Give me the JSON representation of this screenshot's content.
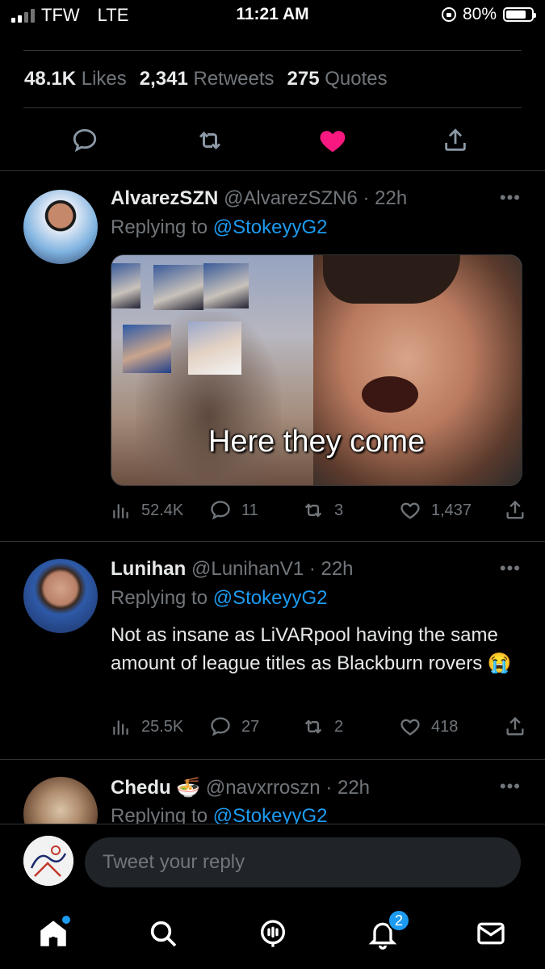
{
  "status_bar": {
    "carrier": "TFW",
    "network": "LTE",
    "time": "11:21 AM",
    "battery": "80%",
    "battery_level": 0.8
  },
  "stats": {
    "likes_count": "48.1K",
    "likes_label": "Likes",
    "retweets_count": "2,341",
    "retweets_label": "Retweets",
    "quotes_count": "275",
    "quotes_label": "Quotes"
  },
  "main_actions": {
    "icons": [
      "reply-icon",
      "retweet-icon",
      "like-icon",
      "share-icon"
    ],
    "liked_color": "#f91880"
  },
  "replies": [
    {
      "name": "AlvarezSZN",
      "handle": "@AlvarezSZN6",
      "time": "· 22h",
      "replying_prefix": "Replying to",
      "replying_to": "@StokeyyG2",
      "body": "",
      "media_caption": "Here they come",
      "views": "52.4K",
      "replies": "11",
      "retweets": "3",
      "likes": "1,437"
    },
    {
      "name": "Lunihan",
      "handle": "@LunihanV1",
      "time": "· 22h",
      "replying_prefix": "Replying to",
      "replying_to": "@StokeyyG2",
      "body": "Not as insane as LiVARpool having the same amount of league titles as Blackburn rovers 😭",
      "views": "25.5K",
      "replies": "27",
      "retweets": "2",
      "likes": "418"
    },
    {
      "name": "Chedu 🍜",
      "handle": "@navxrroszn",
      "time": "· 22h",
      "replying_prefix": "Replying to",
      "replying_to": "@StokeyyG2"
    }
  ],
  "reply_bar": {
    "placeholder": "Tweet your reply"
  },
  "tab_bar": {
    "notifications_badge": "2",
    "accent": "#1d9bf0"
  }
}
